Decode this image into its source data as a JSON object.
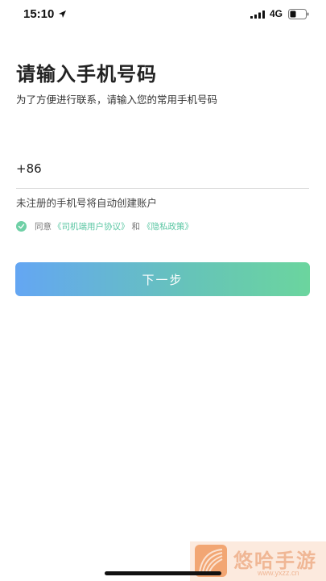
{
  "status_bar": {
    "time": "15:10",
    "network": "4G",
    "icons": [
      "location-arrow-icon",
      "signal-bars-icon",
      "battery-icon"
    ]
  },
  "header": {
    "title": "请输入手机号码",
    "subtitle": "为了方便进行联系，请输入您的常用手机号码"
  },
  "phone_field": {
    "country_code": "+86",
    "value": "",
    "placeholder": ""
  },
  "hint": "未注册的手机号将自动创建账户",
  "agreement": {
    "checked": true,
    "prefix": "同意",
    "user_agreement_link": "《司机端用户协议》",
    "connector": "和",
    "privacy_link": "《隐私政策》"
  },
  "next_button_label": "下一步",
  "watermark": {
    "name": "悠哈手游",
    "url": "www.yxzz.cn"
  },
  "colors": {
    "button_gradient_start": "#64a6f3",
    "button_gradient_end": "#6bd59e",
    "link": "#5cc7a4",
    "check": "#6fd0a6"
  }
}
